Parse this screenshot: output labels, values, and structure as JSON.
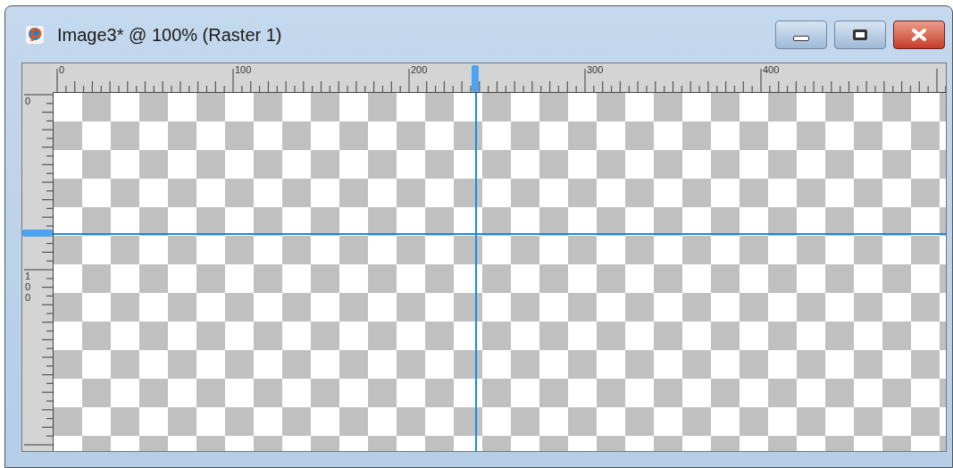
{
  "window": {
    "title": "Image3* @ 100% (Raster 1)"
  },
  "top_ruler": {
    "labels": [
      "0",
      "100",
      "200",
      "300",
      "400"
    ]
  },
  "left_ruler": {
    "labels": [
      "0",
      "100"
    ]
  }
}
